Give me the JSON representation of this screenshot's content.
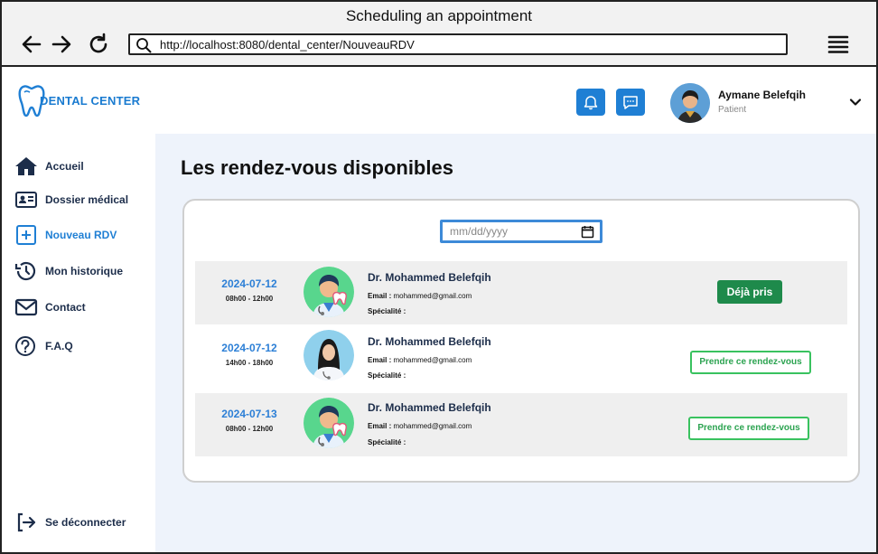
{
  "window": {
    "title": "Scheduling an appointment"
  },
  "browser": {
    "url": "http://localhost:8080/dental_center/NouveauRDV"
  },
  "brand": {
    "name": "DENTAL CENTER",
    "accent": "#1f7fd4"
  },
  "user": {
    "name": "Aymane Belefqih",
    "role": "Patient"
  },
  "sidebar": {
    "items": [
      {
        "label": "Accueil",
        "icon": "home-icon"
      },
      {
        "label": "Dossier médical",
        "icon": "id-card-icon"
      },
      {
        "label": "Nouveau RDV",
        "icon": "plus-square-icon",
        "active": true
      },
      {
        "label": "Mon historique",
        "icon": "history-icon"
      },
      {
        "label": "Contact",
        "icon": "mail-icon"
      },
      {
        "label": "F.A.Q",
        "icon": "question-icon"
      }
    ],
    "logout": "Se déconnecter"
  },
  "main": {
    "title": "Les rendez-vous disponibles",
    "date_placeholder": "mm/dd/yyyy",
    "appointments": [
      {
        "date": "2024-07-12",
        "time": "08h00 - 12h00",
        "doctor": "Dr. Mohammed Belefqih",
        "email_label": "Email :",
        "email": "mohammed@gmail.com",
        "specialty_label": "Spécialité :",
        "button": "Déjà pris",
        "status": "taken"
      },
      {
        "date": "2024-07-12",
        "time": "14h00 - 18h00",
        "doctor": "Dr. Mohammed Belefqih",
        "email_label": "Email :",
        "email": "mohammed@gmail.com",
        "specialty_label": "Spécialité :",
        "button": "Prendre ce rendez-vous",
        "status": "available"
      },
      {
        "date": "2024-07-13",
        "time": "08h00 - 12h00",
        "doctor": "Dr. Mohammed Belefqih",
        "email_label": "Email :",
        "email": "mohammed@gmail.com",
        "specialty_label": "Spécialité :",
        "button": "Prendre ce rendez-vous",
        "status": "available"
      }
    ]
  }
}
